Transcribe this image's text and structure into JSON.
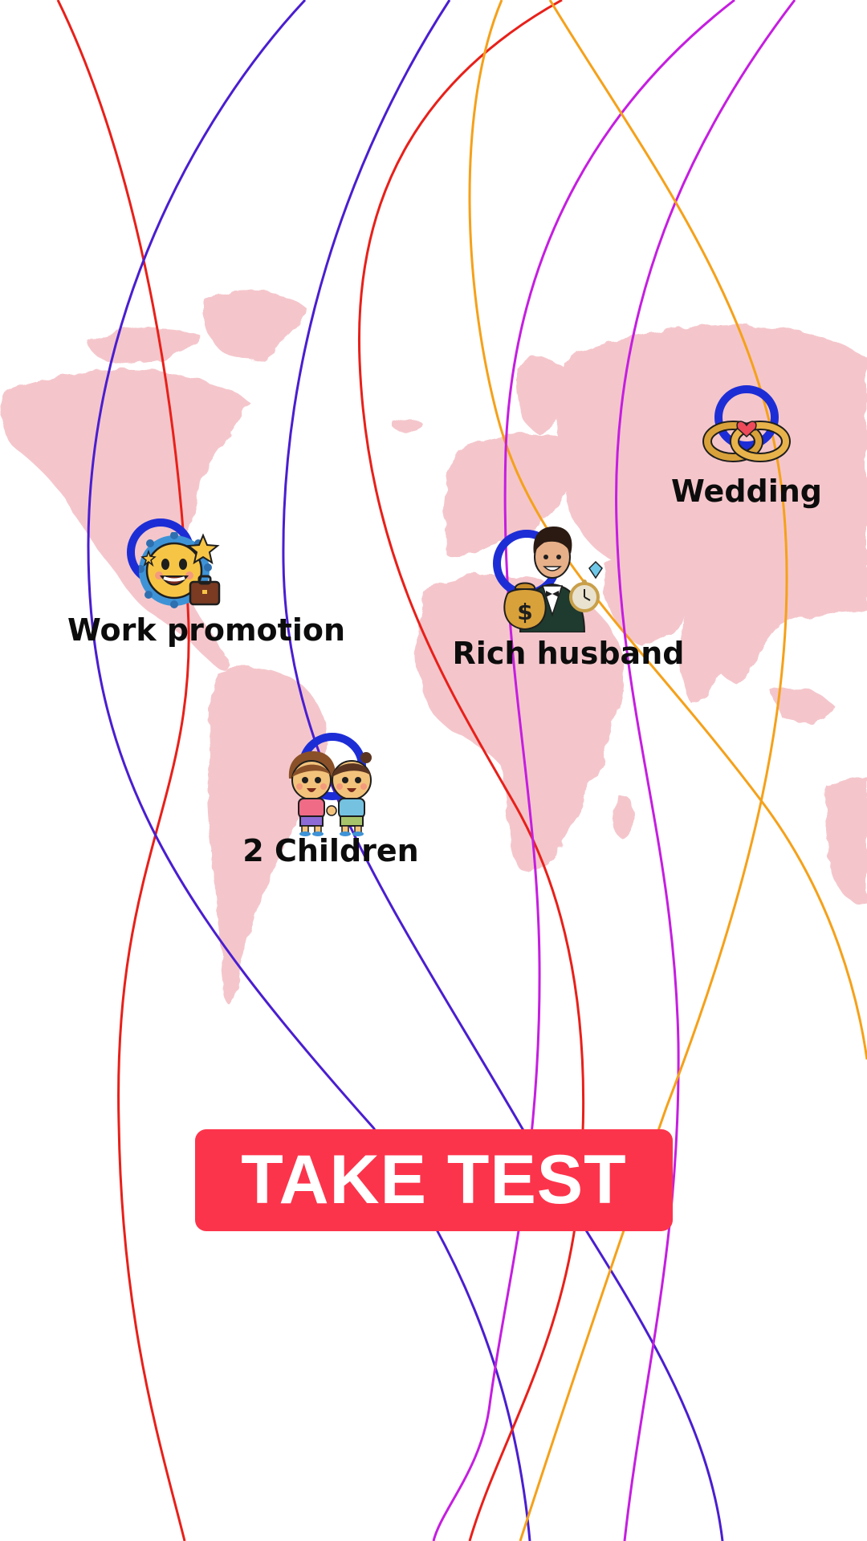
{
  "markers": {
    "work_promotion": {
      "label": "Work promotion",
      "icon": "smiling-sun-with-briefcase-icon"
    },
    "children": {
      "label": "2 Children",
      "icon": "two-children-icon"
    },
    "rich_husband": {
      "label": "Rich husband",
      "icon": "rich-man-with-money-bag-icon"
    },
    "wedding": {
      "label": "Wedding",
      "icon": "wedding-rings-icon"
    }
  },
  "cta": {
    "label": "TAKE TEST"
  },
  "colors": {
    "background": "#ffffff",
    "map": "#f2b8c0",
    "pin_ring": "#1d2dd6",
    "button": "#fc344b",
    "button_text": "#ffffff",
    "line_red": "#e8201a",
    "line_purple": "#4a1ed0",
    "line_magenta": "#c51ee0",
    "line_orange": "#f5a11a"
  }
}
